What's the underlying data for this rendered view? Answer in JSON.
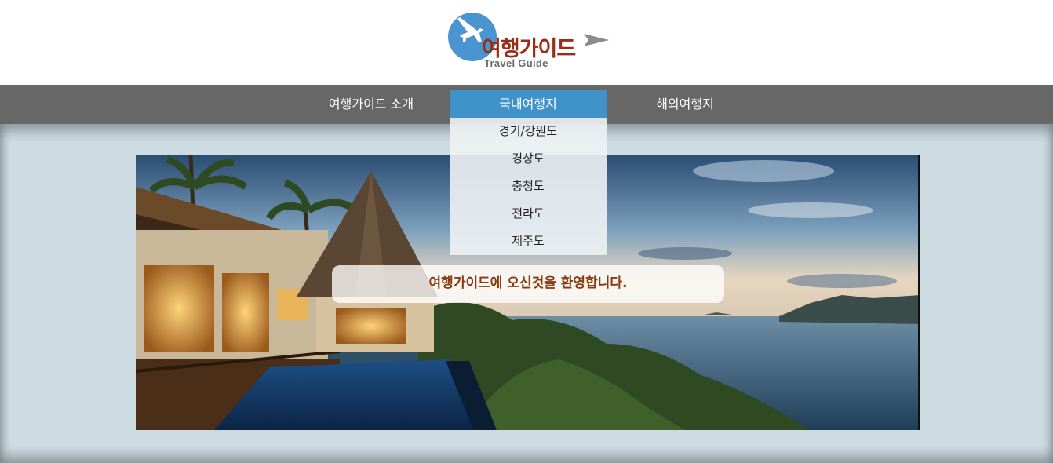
{
  "logo": {
    "title_kr": "여행가이드",
    "title_en": "Travel Guide",
    "icon": "airplane-icon"
  },
  "nav": {
    "items": [
      {
        "label": "여행가이드 소개"
      },
      {
        "label": "국내여행지"
      },
      {
        "label": "해외여행지"
      }
    ],
    "active_color": "#3f93c9",
    "bar_color": "#676767"
  },
  "dropdown": {
    "items": [
      {
        "label": "경기/강원도"
      },
      {
        "label": "경상도"
      },
      {
        "label": "충청도"
      },
      {
        "label": "전라도"
      },
      {
        "label": "제주도"
      }
    ]
  },
  "hero": {
    "welcome_text": "여행가이드에 오신것을 환영합니다."
  },
  "colors": {
    "background": "#cddbe2",
    "welcome_text": "#8a3a10",
    "logo_text": "#9b2d14"
  }
}
